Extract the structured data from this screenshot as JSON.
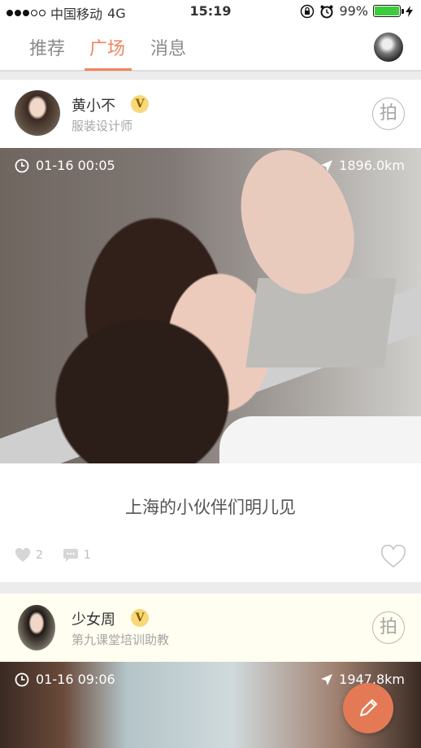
{
  "status_bar": {
    "carrier": "中国移动",
    "network": "4G",
    "time": "15:19",
    "battery": "99%",
    "battery_level": 0.99
  },
  "nav": {
    "tabs": [
      {
        "label": "推荐",
        "active": false
      },
      {
        "label": "广场",
        "active": true
      },
      {
        "label": "消息",
        "active": false
      }
    ]
  },
  "posts": [
    {
      "user": "黄小不",
      "badge": "V",
      "role": "服装设计师",
      "shoot_label": "拍",
      "time": "01-16 00:05",
      "distance": "1896.0km",
      "caption": "上海的小伙伴们明儿见",
      "likes": "2",
      "comments": "1"
    },
    {
      "user": "少女周",
      "badge": "V",
      "role": "第九课堂培训助教",
      "shoot_label": "拍",
      "time": "01-16 09:06",
      "distance": "1947.8km"
    }
  ],
  "colors": {
    "accent": "#f0835f",
    "fab": "#e47a55",
    "badge": "#f7d97a",
    "battery": "#3ccc3c"
  }
}
